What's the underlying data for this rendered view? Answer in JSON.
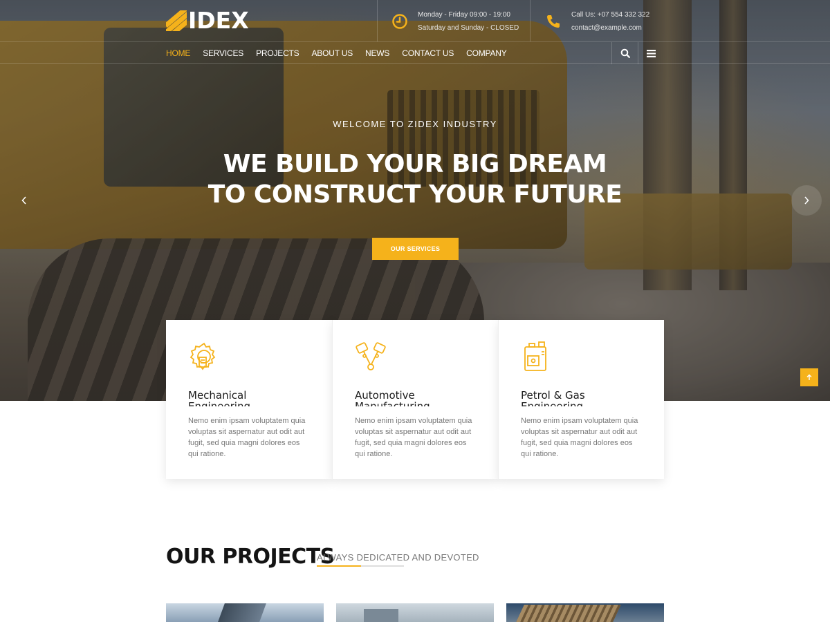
{
  "brand": {
    "logo_text": "IDEX",
    "accent": "#f5b21b"
  },
  "header": {
    "hours": {
      "icon": "clock-icon",
      "line1": "Monday - Friday 09:00 - 19:00",
      "line2": "Saturday and Sunday - CLOSED"
    },
    "contact": {
      "icon": "phone-icon",
      "line1": "Call Us: +07 554 332 322",
      "line2": "contact@example.com"
    }
  },
  "nav": {
    "items": [
      {
        "label": "HOME",
        "active": true
      },
      {
        "label": "SERVICES",
        "active": false
      },
      {
        "label": "PROJECTS",
        "active": false
      },
      {
        "label": "ABOUT US",
        "active": false
      },
      {
        "label": "NEWS",
        "active": false
      },
      {
        "label": "CONTACT US",
        "active": false
      },
      {
        "label": "COMPANY",
        "active": false
      }
    ],
    "tools": [
      "search-icon",
      "menu-icon"
    ]
  },
  "hero": {
    "eyebrow": "WELCOME TO ZIDEX INDUSTRY",
    "headline_line1": "WE BUILD YOUR BIG DREAM",
    "headline_line2": "TO CONSTRUCT YOUR FUTURE",
    "cta_label": "OUR SERVICES",
    "prev_icon": "chevron-left-icon",
    "next_icon": "chevron-right-icon"
  },
  "scroll_top_icon": "arrow-up-icon",
  "services": [
    {
      "icon": "gear-blueprint-icon",
      "title_line1": "Mechanical",
      "title_line2": "Engineering",
      "desc": "Nemo enim ipsam voluptatem quia voluptas sit aspernatur aut odit aut fugit, sed quia magni dolores eos qui ratione."
    },
    {
      "icon": "pistons-icon",
      "title_line1": "Automotive",
      "title_line2": "Manufacturing",
      "desc": "Nemo enim ipsam voluptatem quia voluptas sit aspernatur aut odit aut fugit, sed quia magni dolores eos qui ratione."
    },
    {
      "icon": "fuel-canister-icon",
      "title_line1": "Petrol & Gas",
      "title_line2": "Engineering",
      "desc": "Nemo enim ipsam voluptatem quia voluptas sit aspernatur aut odit aut fugit, sed quia magni dolores eos qui ratione."
    }
  ],
  "projects": {
    "title": "OUR PROJECTS",
    "subtitle": "ALWAYS DEDICATED AND DEVOTED"
  }
}
